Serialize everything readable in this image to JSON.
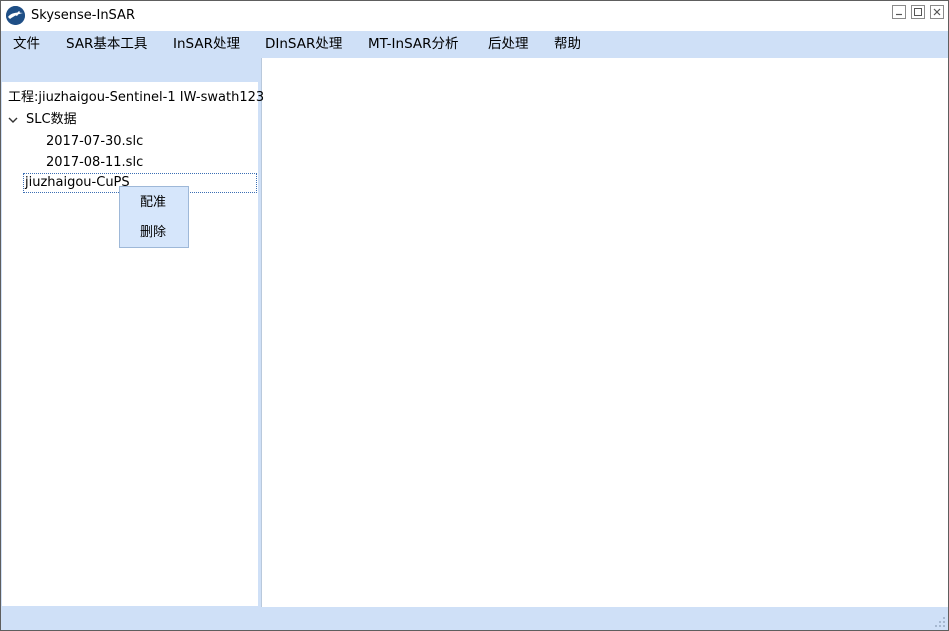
{
  "window": {
    "title": "Skysense-InSAR",
    "app_icon": "skysense-logo-icon",
    "controls": [
      "minimize-icon",
      "maximize-icon",
      "close-icon"
    ]
  },
  "menu": {
    "file": "文件",
    "sar_tools": "SAR基本工具",
    "insar": "InSAR处理",
    "dinsar": "DInSAR处理",
    "mtinsar": "MT-InSAR分析",
    "postprocess": "后处理",
    "help": "帮助"
  },
  "tree": {
    "root": "工程:jiuzhaigou-Sentinel-1 IW-swath123",
    "slc_folder": "SLC数据",
    "slc_files": [
      "2017-07-30.slc",
      "2017-08-11.slc"
    ],
    "cups_node": "jiuzhaigou-CuPS"
  },
  "context_menu": {
    "register": "配准",
    "delete": "删除"
  },
  "colors": {
    "chrome": "#cfe0f7",
    "context_menu": "#d6e6fb",
    "selection_border": "#3c6fb4",
    "app_icon": "#1f4f86"
  }
}
